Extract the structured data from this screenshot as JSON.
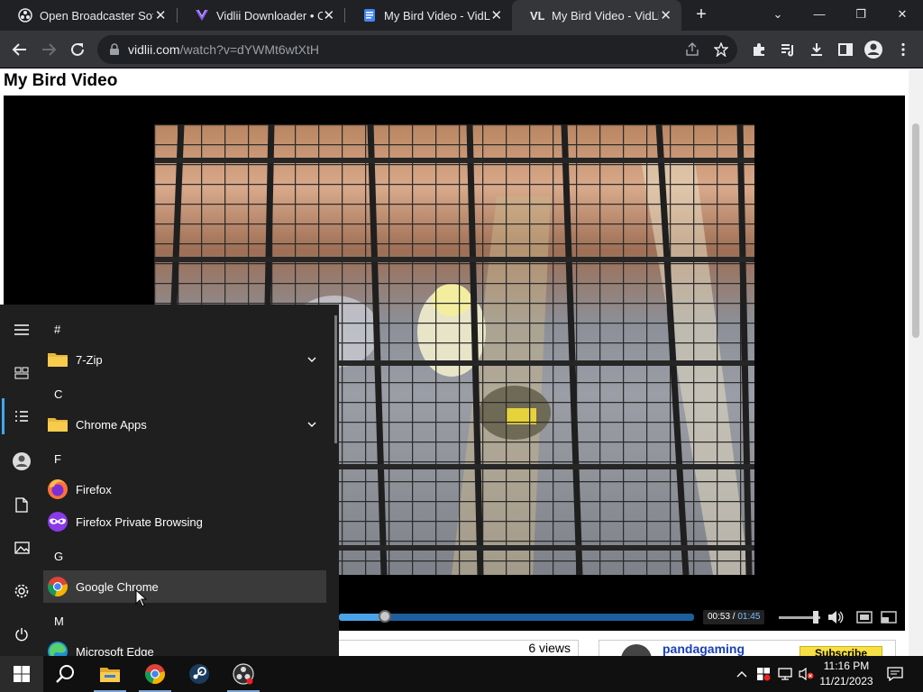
{
  "browser": {
    "tabs": [
      {
        "title": "Open Broadcaster Software",
        "active": false
      },
      {
        "title": "Vidlii Downloader • Co",
        "active": false
      },
      {
        "title": "My Bird Video - VidLii",
        "active": false
      },
      {
        "title": "My Bird Video - VidLii",
        "active": true
      }
    ],
    "url_host": "vidlii.com",
    "url_path": "/watch?v=dYWMt6wtXtH",
    "accent_color": "#202124"
  },
  "page": {
    "video_title": "My Bird Video",
    "time_current": "00:53",
    "time_separator": " / ",
    "time_duration": "01:45",
    "progress_fraction": 0.13,
    "volume_fraction": 0.9,
    "views_text": "6 views",
    "channel_name": "pandagaming",
    "subscribe_label": "Subscribe"
  },
  "start_menu": {
    "sections": [
      {
        "letter": "#",
        "apps": [
          {
            "name": "7-Zip",
            "icon": "folder-icon",
            "expandable": true
          }
        ]
      },
      {
        "letter": "C",
        "apps": [
          {
            "name": "Chrome Apps",
            "icon": "folder-icon",
            "expandable": true
          }
        ]
      },
      {
        "letter": "F",
        "apps": [
          {
            "name": "Firefox",
            "icon": "firefox-icon",
            "expandable": false
          },
          {
            "name": "Firefox Private Browsing",
            "icon": "firefox-private-icon",
            "expandable": false
          }
        ]
      },
      {
        "letter": "G",
        "apps": [
          {
            "name": "Google Chrome",
            "icon": "chrome-icon",
            "expandable": false,
            "hover": true
          }
        ]
      },
      {
        "letter": "M",
        "apps": [
          {
            "name": "Microsoft Edge",
            "icon": "edge-icon",
            "expandable": false
          }
        ]
      }
    ]
  },
  "taskbar": {
    "time": "11:16 PM",
    "date": "11/21/2023",
    "pinned": [
      "start-icon",
      "search-icon",
      "file-explorer-icon",
      "chrome-icon",
      "steam-icon",
      "obs-icon"
    ]
  }
}
